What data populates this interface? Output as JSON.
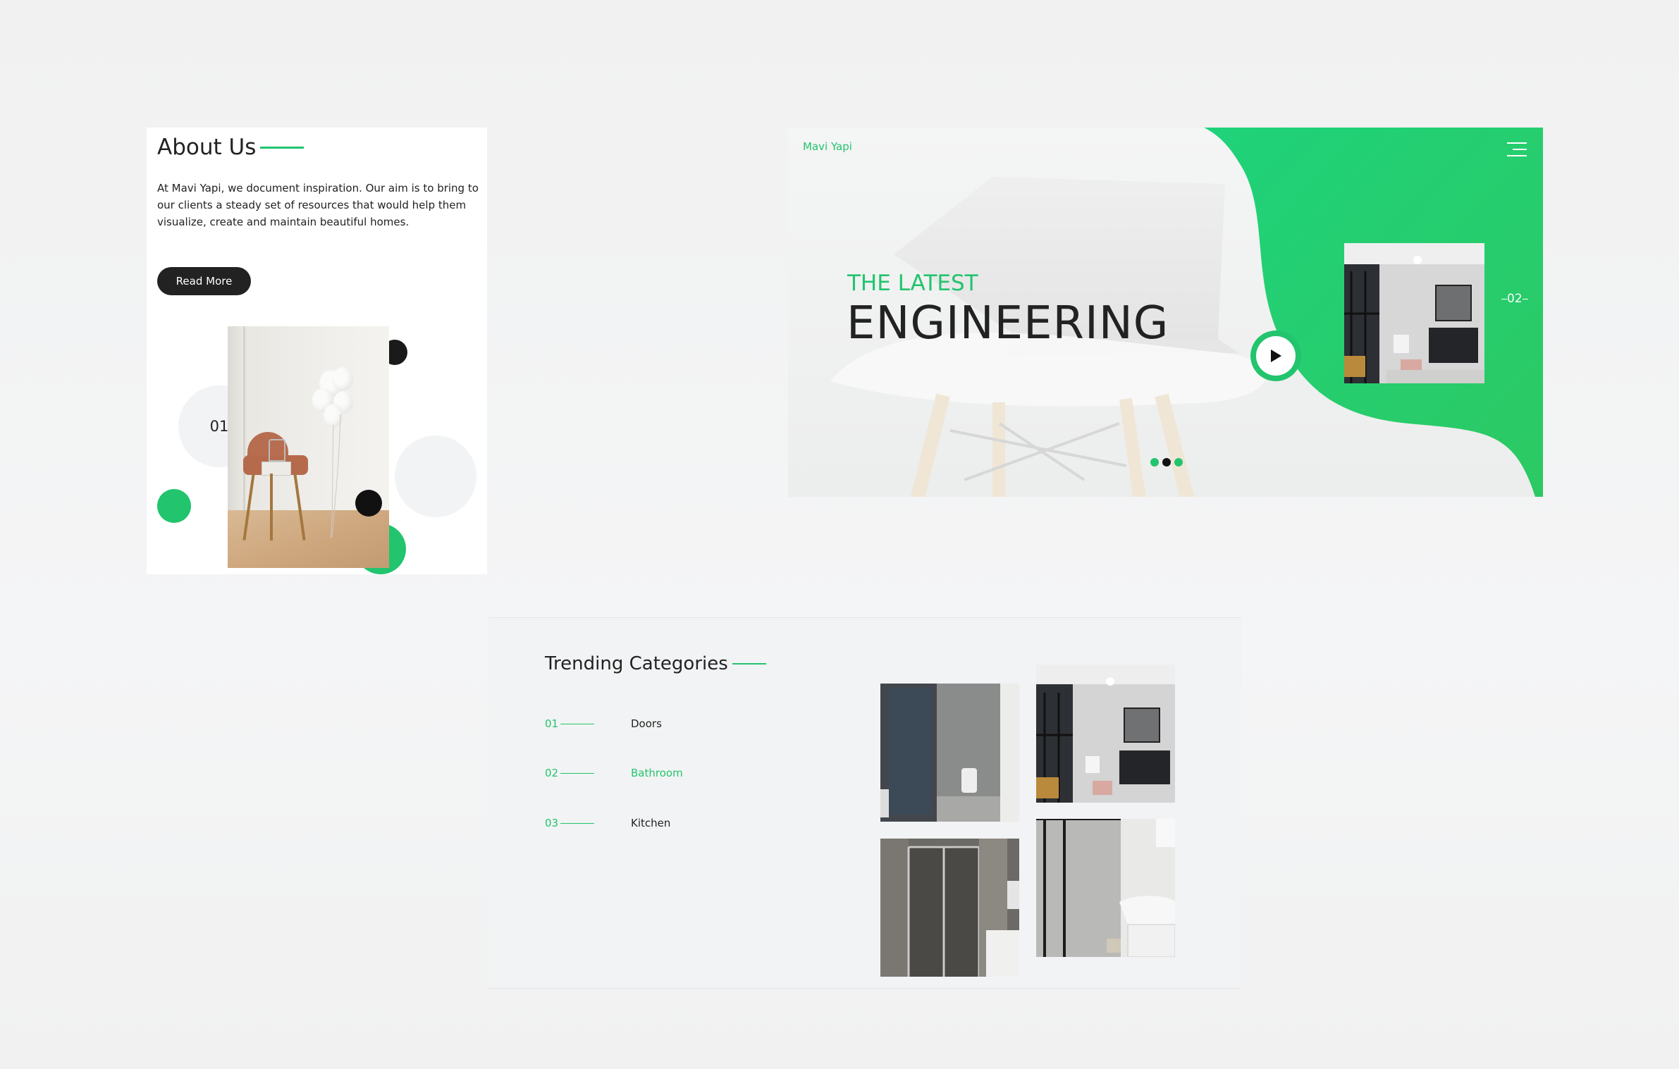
{
  "about": {
    "title": "About Us",
    "text": "At Mavi Yapi, we document inspiration. Our aim is to bring to our clients a steady set of resources that would help them visualize, create and maintain beautiful homes.",
    "button_label": "Read More",
    "slide_number": "01"
  },
  "hero": {
    "brand": "Mavi Yapi",
    "eyebrow": "THE LATEST",
    "title": "ENGINEERING",
    "slide_number": "02",
    "dots": [
      "green",
      "black",
      "green"
    ]
  },
  "categories": {
    "title": "Trending Categories",
    "items": [
      {
        "number": "01",
        "label": "Doors",
        "active": false
      },
      {
        "number": "02",
        "label": "Bathroom",
        "active": true
      },
      {
        "number": "03",
        "label": "Kitchen",
        "active": false
      }
    ]
  },
  "colors": {
    "accent": "#22c46e",
    "dark": "#222222",
    "panel": "#f2f3f4"
  },
  "icons": {
    "menu": "hamburger-menu-icon",
    "play": "play-icon"
  }
}
